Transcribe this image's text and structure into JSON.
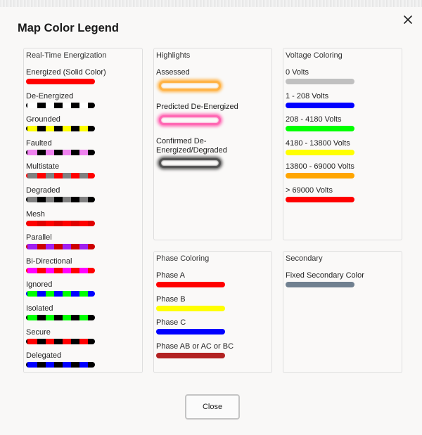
{
  "dialog": {
    "title": "Map Color Legend",
    "close_label": "Close"
  },
  "icons": {
    "close": "close-icon"
  },
  "panels": {
    "energization": {
      "heading": "Real-Time Energization",
      "items": [
        {
          "label": "Energized (Solid Color)",
          "colors": [
            "#ff0000",
            "#ff0000"
          ]
        },
        {
          "label": "De-Energized",
          "colors": [
            "#ffffff",
            "#000000"
          ]
        },
        {
          "label": "Grounded",
          "colors": [
            "#ffff00",
            "#000000"
          ]
        },
        {
          "label": "Faulted",
          "colors": [
            "#ee82ee",
            "#000000"
          ]
        },
        {
          "label": "Multistate",
          "colors": [
            "#808080",
            "#ff0000"
          ]
        },
        {
          "label": "Degraded",
          "colors": [
            "#808080",
            "#000000"
          ]
        },
        {
          "label": "Mesh",
          "colors": [
            "#ff0000",
            "#e00000"
          ]
        },
        {
          "label": "Parallel",
          "colors": [
            "#a020f0",
            "#cc0000"
          ]
        },
        {
          "label": "Bi-Directional",
          "colors": [
            "#ff00ff",
            "#ff0000"
          ]
        },
        {
          "label": "Ignored",
          "colors": [
            "#00ff00",
            "#0000ff"
          ]
        },
        {
          "label": "Isolated",
          "colors": [
            "#00ff00",
            "#000000"
          ]
        },
        {
          "label": "Secure",
          "colors": [
            "#ff0000",
            "#000000"
          ]
        },
        {
          "label": "Delegated",
          "colors": [
            "#0000ff",
            "#000000"
          ]
        }
      ]
    },
    "highlights": {
      "heading": "Highlights",
      "items": [
        {
          "label": "Assessed",
          "color": "#ffb347"
        },
        {
          "label": "Predicted De-Energized",
          "color": "#ff69b4"
        },
        {
          "label": "Confirmed De-Energized/Degraded",
          "color": "#555555"
        }
      ]
    },
    "voltage": {
      "heading": "Voltage Coloring",
      "items": [
        {
          "label": "0 Volts",
          "color": "#c0c0c0"
        },
        {
          "label": "1 - 208 Volts",
          "color": "#0000ff"
        },
        {
          "label": "208 - 4180 Volts",
          "color": "#00ff00"
        },
        {
          "label": "4180 - 13800 Volts",
          "color": "#ffff00"
        },
        {
          "label": "13800 - 69000 Volts",
          "color": "#ffa500"
        },
        {
          "label": "> 69000 Volts",
          "color": "#ff0000"
        }
      ]
    },
    "phase": {
      "heading": "Phase Coloring",
      "items": [
        {
          "label": "Phase A",
          "color": "#ff0000"
        },
        {
          "label": "Phase B",
          "color": "#ffff00"
        },
        {
          "label": "Phase C",
          "color": "#0000ff"
        },
        {
          "label": "Phase AB or AC or BC",
          "color": "#b22222"
        }
      ]
    },
    "secondary": {
      "heading": "Secondary",
      "items": [
        {
          "label": "Fixed Secondary Color",
          "color": "#708090"
        }
      ]
    }
  }
}
